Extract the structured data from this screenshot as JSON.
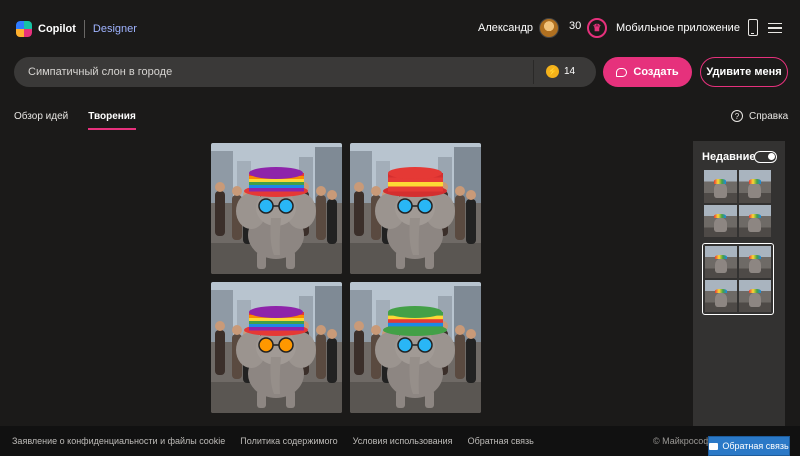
{
  "header": {
    "brand": "Copilot",
    "product": "Designer",
    "user_name": "Александр",
    "coins": "30",
    "mobile_app_label": "Мобильное приложение"
  },
  "prompt": {
    "value": "Симпатичный слон в городе",
    "boosts": "14",
    "create_label": "Создать",
    "surprise_label": "Удивите меня"
  },
  "tabs": [
    {
      "label": "Обзор идей"
    },
    {
      "label": "Творения"
    }
  ],
  "help_label": "Справка",
  "gallery": {
    "images": [
      {
        "hat": "rainbow",
        "glasses": "blue"
      },
      {
        "hat": "red",
        "glasses": "blue"
      },
      {
        "hat": "rainbow",
        "glasses": "orange"
      },
      {
        "hat": "green",
        "glasses": "blue"
      }
    ]
  },
  "recent": {
    "title": "Недавние"
  },
  "footer": {
    "links": [
      "Заявление о конфиденциальности и файлы cookie",
      "Политика содержимого",
      "Условия использования",
      "Обратная связь"
    ],
    "copyright": "© Майкрософт",
    "feedback_button": "Обратная связь"
  },
  "colors": {
    "accent": "#e6317c",
    "background": "#1b1a19",
    "feedback_blue": "#2b79c7"
  }
}
